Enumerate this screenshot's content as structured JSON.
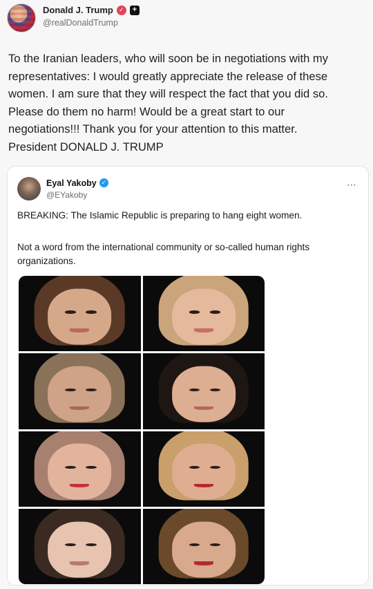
{
  "post": {
    "author": {
      "display_name": "Donald J. Trump",
      "handle": "@realDonaldTrump"
    },
    "text": "To the Iranian leaders, who will soon be in negotiations with my\nrepresentatives: I would greatly appreciate the release of these\nwomen. I am sure that they will respect the fact that you did so.\nPlease do them no harm! Would be a great start to our\nnegotiations!!! Thank you for your attention to this matter.\nPresident DONALD J. TRUMP",
    "icons": {
      "verified": "verified-badge-icon",
      "plus": "plus-square-icon"
    },
    "colors": {
      "verified_badge": "#e2445c",
      "quote_verified": "#1d9bf0"
    }
  },
  "quote": {
    "author": {
      "display_name": "Eyal Yakoby",
      "handle": "@EYakoby"
    },
    "more_icon": "⋯",
    "text_line1": "BREAKING: The Islamic Republic is preparing to hang eight women.",
    "text_line2": "Not a word from the international community or so-called human rights organizations."
  }
}
